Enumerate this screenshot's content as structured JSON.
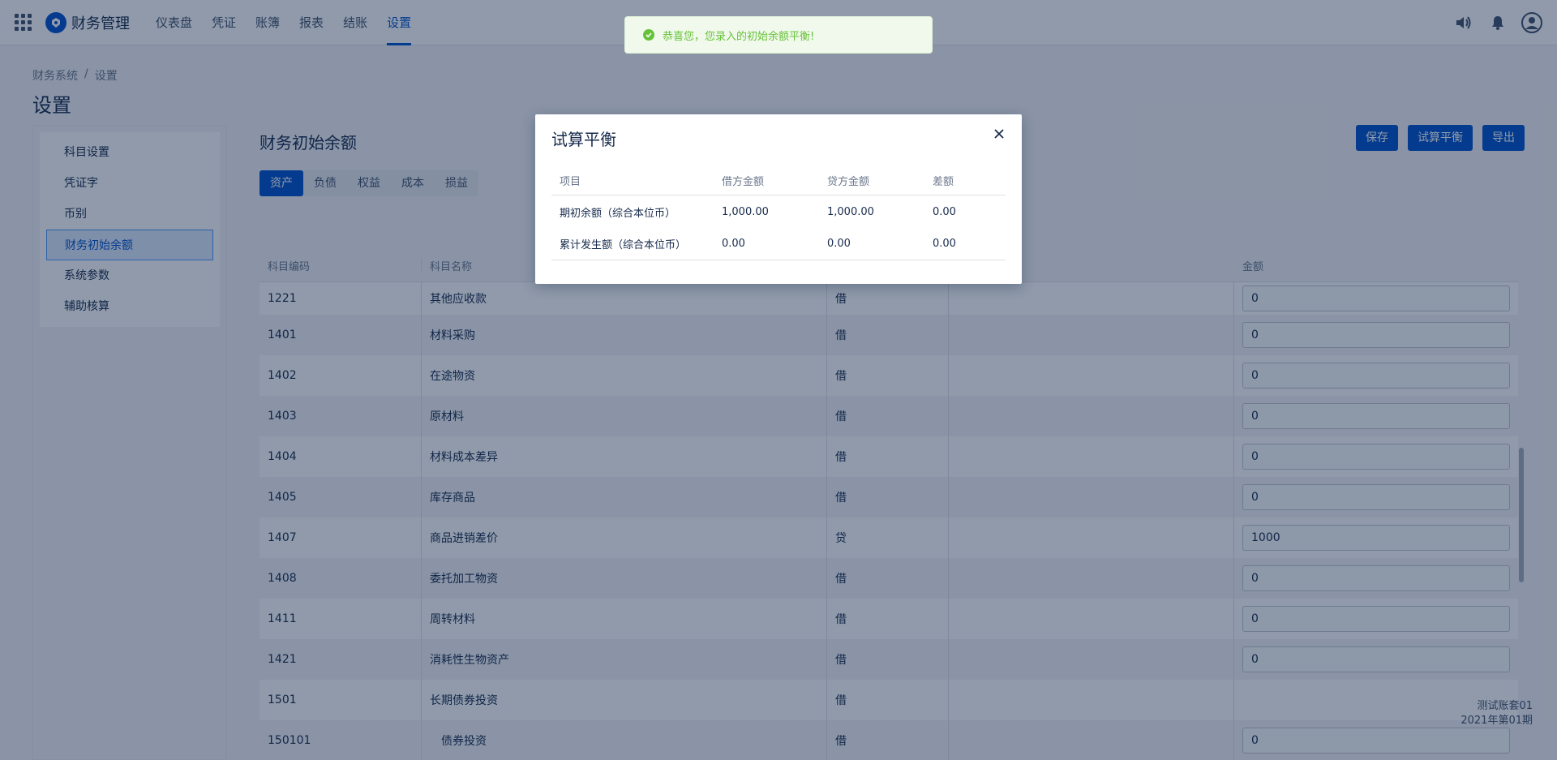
{
  "header": {
    "app_name": "财务管理",
    "nav": [
      "仪表盘",
      "凭证",
      "账簿",
      "报表",
      "结账",
      "设置"
    ],
    "active_nav": "设置"
  },
  "breadcrumb": [
    "财务系统",
    "/",
    "设置"
  ],
  "page_title": "设置",
  "sidebar": {
    "items": [
      "科目设置",
      "凭证字",
      "币别",
      "财务初始余额",
      "系统参数",
      "辅助核算"
    ],
    "active": "财务初始余额"
  },
  "main": {
    "title": "财务初始余额",
    "tabs": [
      "资产",
      "负债",
      "权益",
      "成本",
      "损益"
    ],
    "active_tab": "资产",
    "buttons": {
      "save": "保存",
      "trial_balance": "试算平衡",
      "export": "导出"
    }
  },
  "table": {
    "headers": {
      "code": "科目编码",
      "name": "科目名称",
      "amount": "金额"
    },
    "rows": [
      {
        "code": "1221",
        "name": "其他应收款",
        "dir": "借",
        "amount": "0"
      },
      {
        "code": "1401",
        "name": "材料采购",
        "dir": "借",
        "amount": "0"
      },
      {
        "code": "1402",
        "name": "在途物资",
        "dir": "借",
        "amount": "0"
      },
      {
        "code": "1403",
        "name": "原材料",
        "dir": "借",
        "amount": "0"
      },
      {
        "code": "1404",
        "name": "材料成本差异",
        "dir": "借",
        "amount": "0"
      },
      {
        "code": "1405",
        "name": "库存商品",
        "dir": "借",
        "amount": "0"
      },
      {
        "code": "1407",
        "name": "商品进销差价",
        "dir": "贷",
        "amount": "1000"
      },
      {
        "code": "1408",
        "name": "委托加工物资",
        "dir": "借",
        "amount": "0"
      },
      {
        "code": "1411",
        "name": "周转材料",
        "dir": "借",
        "amount": "0"
      },
      {
        "code": "1421",
        "name": "消耗性生物资产",
        "dir": "借",
        "amount": "0"
      },
      {
        "code": "1501",
        "name": "长期债券投资",
        "dir": "借",
        "amount": ""
      },
      {
        "code": "150101",
        "name": "债券投资",
        "dir": "借",
        "amount": "0"
      }
    ]
  },
  "ledger_info": {
    "name": "测试账套01",
    "period": "2021年第01期"
  },
  "toast": {
    "message": "恭喜您，您录入的初始余额平衡!"
  },
  "modal": {
    "title": "试算平衡",
    "headers": [
      "项目",
      "借方金额",
      "贷方金额",
      "差额"
    ],
    "rows": [
      [
        "期初余额（综合本位币）",
        "1,000.00",
        "1,000.00",
        "0.00"
      ],
      [
        "累计发生额（综合本位币）",
        "0.00",
        "0.00",
        "0.00"
      ]
    ]
  },
  "colors": {
    "primary": "#0052cc",
    "success": "#67c23a",
    "overlay": "rgba(9,30,66,0.45)"
  }
}
